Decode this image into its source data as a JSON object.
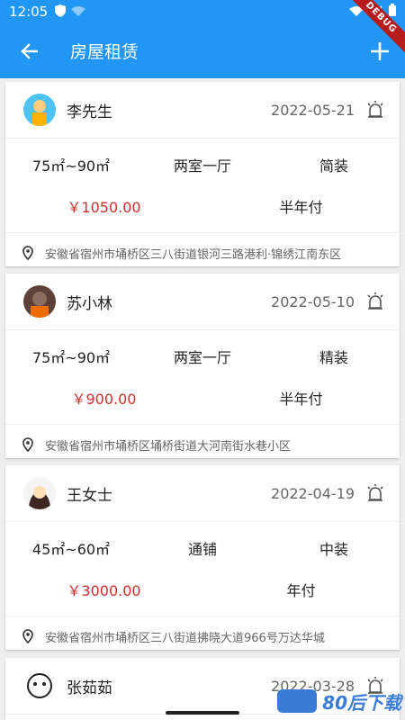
{
  "status_bar": {
    "time": "12:05"
  },
  "app_bar": {
    "title": "房屋租赁",
    "debug_label": "DEBUG"
  },
  "listings": [
    {
      "name": "李先生",
      "date": "2022-05-21",
      "area": "75㎡~90㎡",
      "layout": "两室一厅",
      "decoration": "简装",
      "price": "￥1050.00",
      "period": "半年付",
      "address": "安徽省宿州市埇桥区三八街道银河三路港利·锦绣江南东区"
    },
    {
      "name": "苏小林",
      "date": "2022-05-10",
      "area": "75㎡~90㎡",
      "layout": "两室一厅",
      "decoration": "精装",
      "price": "￥900.00",
      "period": "半年付",
      "address": "安徽省宿州市埇桥区埇桥街道大河南街水巷小区"
    },
    {
      "name": "王女士",
      "date": "2022-04-19",
      "area": "45㎡~60㎡",
      "layout": "通铺",
      "decoration": "中装",
      "price": "￥3000.00",
      "period": "年付",
      "address": "安徽省宿州市埇桥区三八街道拂晓大道966号万达华城"
    },
    {
      "name": "张茹茹",
      "date": "2022-03-28"
    }
  ],
  "watermark": {
    "text": "80后下载"
  }
}
